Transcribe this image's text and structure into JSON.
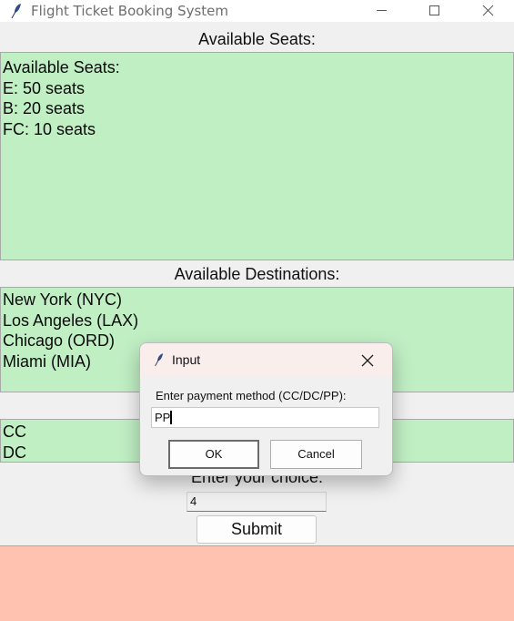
{
  "window": {
    "title": "Flight Ticket Booking System",
    "icon": "feather-icon",
    "controls": [
      "minimize-icon",
      "maximize-icon",
      "close-icon"
    ]
  },
  "seats_section": {
    "heading": "Available Seats:",
    "lines": [
      "Available Seats:",
      "E: 50 seats",
      "B: 20 seats",
      "FC: 10 seats"
    ]
  },
  "destinations_section": {
    "heading": "Available Destinations:",
    "lines": [
      "New York (NYC)",
      "Los Angeles (LAX)",
      "Chicago (ORD)",
      "Miami (MIA)"
    ]
  },
  "payment_list": {
    "lines": [
      "CC",
      "DC"
    ]
  },
  "choice": {
    "label": "Enter your choice:",
    "value": "4"
  },
  "submit_label": "Submit",
  "dialog": {
    "title": "Input",
    "prompt": "Enter payment method (CC/DC/PP):",
    "entry_value": "PP",
    "ok_label": "OK",
    "cancel_label": "Cancel"
  },
  "colors": {
    "panel_green": "#c1efc4",
    "output_salmon": "#ffc2b0",
    "window_bg": "#f0f0f0",
    "dialog_titlebar": "#faeeec"
  }
}
